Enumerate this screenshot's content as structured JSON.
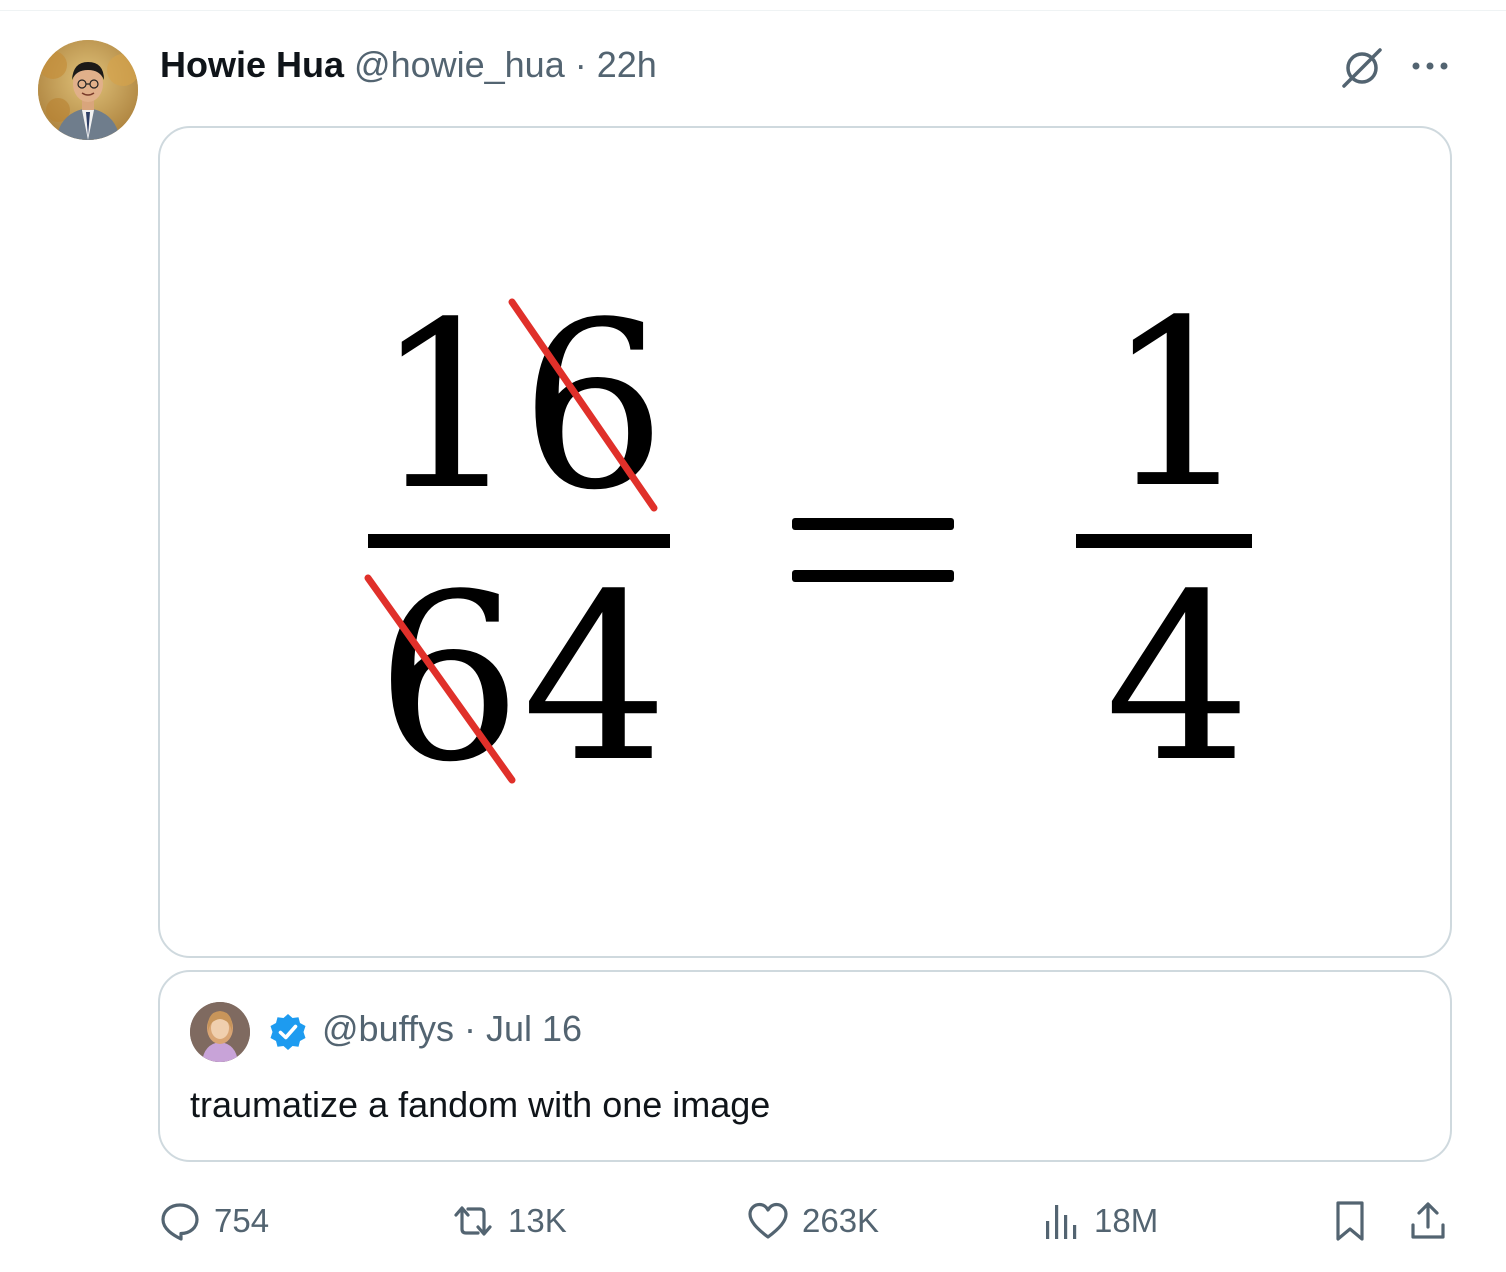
{
  "tweet": {
    "author": {
      "display_name": "Howie Hua",
      "handle": "@howie_hua",
      "separator": "·",
      "time": "22h"
    },
    "media": {
      "numerator_left": "16",
      "denominator_left": "64",
      "equals": "=",
      "numerator_right": "1",
      "denominator_right": "4",
      "strike_color": "#e0302a"
    },
    "quote": {
      "handle": "@buffys",
      "separator": "·",
      "date": "Jul 16",
      "text": "traumatize a fandom with one image"
    },
    "actions": {
      "replies": "754",
      "reposts": "13K",
      "likes": "263K",
      "views": "18M"
    },
    "icons": [
      "grok-icon",
      "more-icon",
      "verified-icon",
      "reply-icon",
      "repost-icon",
      "like-icon",
      "views-icon",
      "bookmark-icon",
      "share-icon"
    ],
    "colors": {
      "text_primary": "#0f1419",
      "text_secondary": "#536471",
      "border": "#cfd9de",
      "verified": "#1d9bf0"
    }
  }
}
